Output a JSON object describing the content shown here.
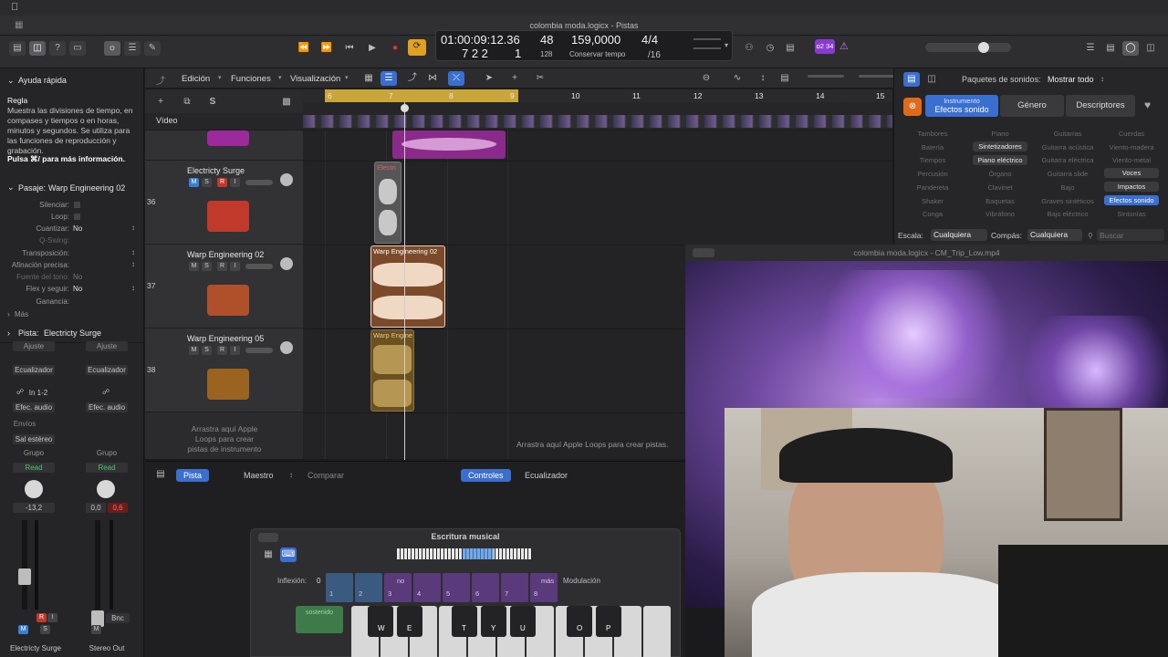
{
  "window": {
    "title": "colombia moda.logicx - Pistas"
  },
  "lcd": {
    "position": "01:00:09:12.36",
    "bar_beat": "7  2  2",
    "sub": "1",
    "bar_num": "48",
    "div": "128",
    "tempo": "159,0000",
    "tempo_mode": "Conservar tempo",
    "signature": "4/4",
    "division": "/16"
  },
  "toolbar": {
    "count_in": "ɒ2 34"
  },
  "inspector": {
    "quick_help_title": "Ayuda rápida",
    "help_heading": "Regla",
    "help_text": "Muestra las divisiones de tiempo, en compases y tiempos o en horas, minutos y segundos. Se utiliza para las funciones de reproducción y grabación.",
    "help_more": "Pulsa ⌘/ para más información.",
    "region_label": "Pasaje:",
    "region_name": "Warp Engineering 02",
    "params": [
      {
        "label": "Silenciar:",
        "value": ""
      },
      {
        "label": "Loop:",
        "value": ""
      },
      {
        "label": "Cuantizar:",
        "value": "No"
      },
      {
        "label": "Q-Swing:",
        "value": ""
      },
      {
        "label": "Transposición:",
        "value": ""
      },
      {
        "label": "Afinación precisa:",
        "value": ""
      },
      {
        "label": "Fuente del tono:",
        "value": "No"
      },
      {
        "label": "Flex y seguir:",
        "value": "No"
      },
      {
        "label": "Ganancia:",
        "value": ""
      }
    ],
    "more": "Más",
    "track_label": "Pista:",
    "track_name": "Electricty Surge",
    "strip1": {
      "setting": "Ajuste",
      "eq": "Ecualizador",
      "input": "In 1-2",
      "fx": "Efec. audio",
      "sends": "Envíos",
      "output": "Sal estéreo",
      "group": "Grupo",
      "auto": "Read",
      "vol": "-13,2",
      "name": "Electricty Surge"
    },
    "strip2": {
      "setting": "Ajuste",
      "eq": "Ecualizador",
      "fx": "Efec. audio",
      "group": "Grupo",
      "auto": "Read",
      "vol": "0,0",
      "peak": "0,6",
      "bnc": "Bnc",
      "name": "Stereo Out"
    },
    "msr": {
      "m": "M",
      "s": "S",
      "r": "R",
      "i": "I"
    }
  },
  "tracks_menu": {
    "edit": "Edición",
    "functions": "Funciones",
    "view": "Visualización"
  },
  "ruler": {
    "marks": [
      "6",
      "7",
      "8",
      "9",
      "10",
      "11",
      "12",
      "13",
      "14",
      "15"
    ]
  },
  "video_track": "Vídeo",
  "tracks": [
    {
      "num": "36",
      "name": "Electricty Surge",
      "region": "Electri"
    },
    {
      "num": "37",
      "name": "Warp Engineering 02",
      "region": "Warp Engineering 02"
    },
    {
      "num": "38",
      "name": "Warp Engineering 05",
      "region": "Warp Engine"
    }
  ],
  "drop_hint_headers": "Arrastra aquí Apple Loops para crear pistas de instrumento",
  "drop_hint_lanes": "Arrastra aquí Apple Loops para crear pistas.",
  "editor": {
    "tab_track": "Pista",
    "tab_master": "Maestro",
    "tab_compare": "Comparar",
    "tab_controls": "Controles",
    "tab_eq": "Ecualizador"
  },
  "musical_typing": {
    "title": "Escritura musical",
    "pitch_label": "Inflexión:",
    "pitch_value": "0",
    "mod_label": "Modulación",
    "pads": [
      "",
      "",
      "no",
      "",
      "",
      "",
      "",
      "más"
    ],
    "pad_nums": [
      "1",
      "2",
      "3",
      "4",
      "5",
      "6",
      "7",
      "8"
    ],
    "sustain": "sostenido",
    "black_keys": [
      "W",
      "E",
      "T",
      "Y",
      "U",
      "O",
      "P"
    ]
  },
  "library": {
    "sounds_label": "Paquetes de sonidos:",
    "sounds_value": "Mostrar todo",
    "instrument": "Instrumento",
    "instrument_sub": "Efectos sonido",
    "genre": "Género",
    "descriptors": "Descriptores",
    "cells": [
      [
        "Tambores",
        "Piano",
        "Guitarras",
        "Cuerdas"
      ],
      [
        "Batería",
        "Sintetizadores",
        "Guitarra acústica",
        "Viento-madera"
      ],
      [
        "Tiempos",
        "Piano eléctrico",
        "Guitarra eléctrica",
        "Viento-metal"
      ],
      [
        "Percusión",
        "Órgano",
        "Guitarra slide",
        "Voces"
      ],
      [
        "Pandereta",
        "Clavinet",
        "Bajo",
        "Impactos"
      ],
      [
        "Shaker",
        "Baquetas",
        "Graves sintéticos",
        "Efectos sonido"
      ],
      [
        "Conga",
        "Vibráfono",
        "Bajo eléctrico",
        "Sintonías"
      ]
    ],
    "scale_label": "Escala:",
    "scale_value": "Cualquiera",
    "sig_label": "Compás:",
    "sig_value": "Cualquiera",
    "search_placeholder": "Buscar"
  },
  "video_window": {
    "title": "colombia moda.logicx - CM_Trip_Low.mp4"
  }
}
